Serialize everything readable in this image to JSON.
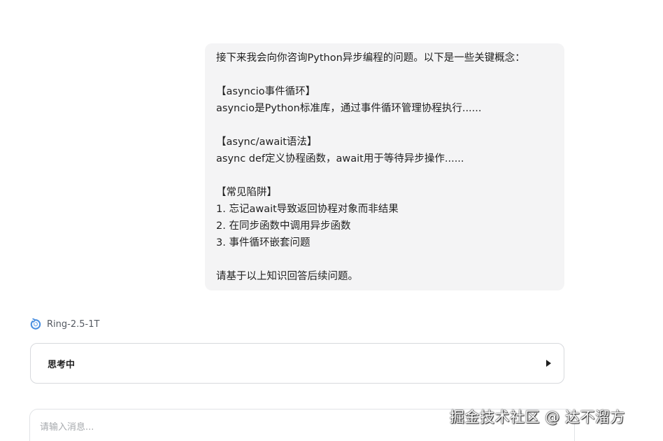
{
  "user_message": {
    "lines": [
      "接下来我会向你咨询Python异步编程的问题。以下是一些关键概念：",
      "",
      "【asyncio事件循环】",
      "asyncio是Python标准库，通过事件循环管理协程执行......",
      "",
      "【async/await语法】",
      "async def定义协程函数，await用于等待异步操作......",
      "",
      "【常见陷阱】",
      "1. 忘记await导致返回协程对象而非结果",
      "2. 在同步函数中调用异步函数",
      "3. 事件循环嵌套问题",
      "",
      "请基于以上知识回答后续问题。"
    ]
  },
  "assistant": {
    "model_name": "Ring-2.5-1T",
    "model_icon": "ring-logo-icon",
    "thinking_label": "思考中",
    "thinking_icon": "triangle-right-icon"
  },
  "composer": {
    "placeholder": "请输入消息..."
  },
  "watermark": {
    "text": "掘金技术社区 @ 达不溜方"
  },
  "colors": {
    "bubble_bg": "#f4f4f5",
    "border": "#d7d9dd",
    "icon_blue": "#4a8fe0"
  }
}
